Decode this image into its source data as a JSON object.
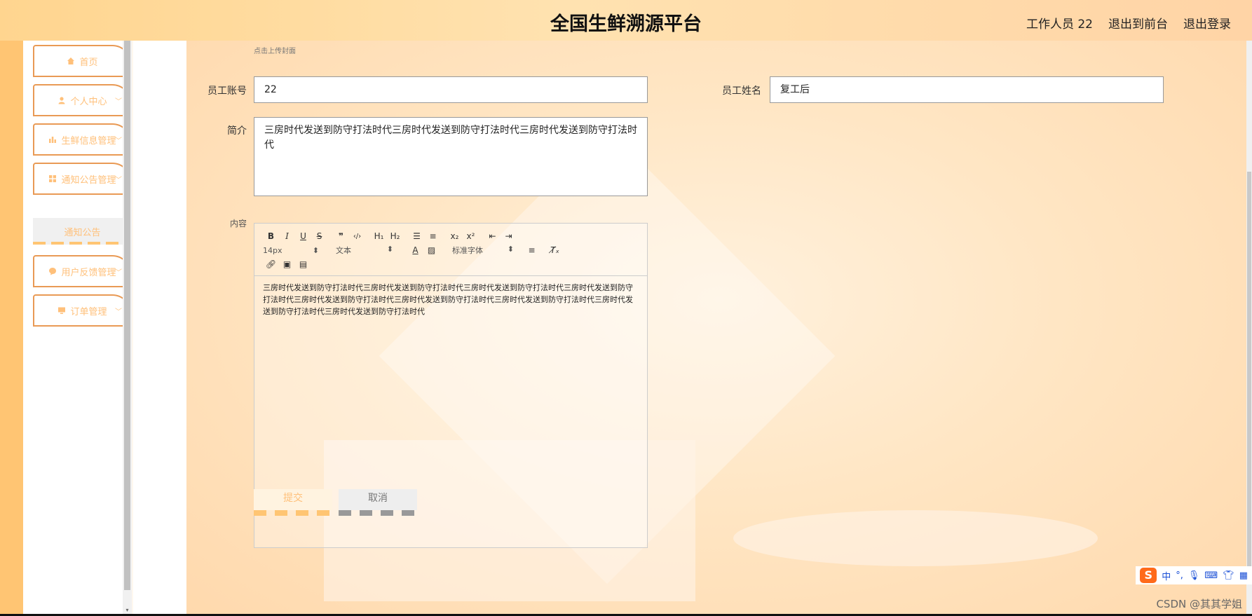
{
  "header": {
    "title": "全国生鲜溯源平台",
    "user": "工作人员 22",
    "to_front": "退出到前台",
    "logout": "退出登录"
  },
  "sidebar": {
    "items": [
      {
        "label": "首页",
        "icon": "home-icon"
      },
      {
        "label": "个人中心",
        "icon": "user-icon"
      },
      {
        "label": "生鲜信息管理",
        "icon": "chart-icon"
      },
      {
        "label": "通知公告管理",
        "icon": "grid-icon"
      },
      {
        "label": "用户反馈管理",
        "icon": "feedback-icon"
      },
      {
        "label": "订单管理",
        "icon": "monitor-icon"
      }
    ],
    "sub_item": "通知公告"
  },
  "form": {
    "cover_hint": "点击上传封面",
    "account_label": "员工账号",
    "account_value": "22",
    "name_label": "员工姓名",
    "name_value": "复工后",
    "intro_label": "简介",
    "intro_value": "三房时代发送到防守打法时代三房时代发送到防守打法时代三房时代发送到防守打法时代",
    "content_label": "内容",
    "editor": {
      "size_select": "14px",
      "type_select": "文本",
      "font_select": "标准字体",
      "body": "三房时代发送到防守打法时代三房时代发送到防守打法时代三房时代发送到防守打法时代三房时代发送到防守打法时代三房时代发送到防守打法时代三房时代发送到防守打法时代三房时代发送到防守打法时代三房时代发送到防守打法时代三房时代发送到防守打法时代"
    },
    "submit": "提交",
    "cancel": "取消"
  },
  "ime": {
    "logo": "S",
    "mode": "中"
  },
  "watermark": "CSDN @其其学姐"
}
